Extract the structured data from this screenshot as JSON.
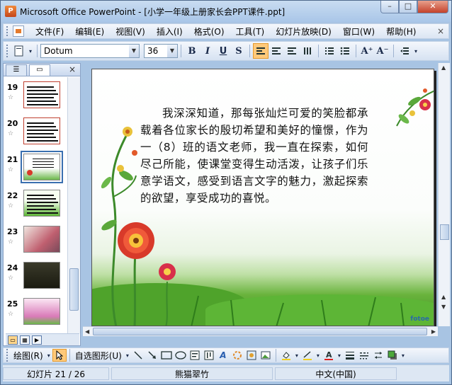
{
  "window": {
    "title": "Microsoft Office PowerPoint - [小学一年级上册家长会PPT课件.ppt]",
    "app_icon": "P",
    "controls": {
      "minimize": "–",
      "maximize": "□",
      "close": "✕"
    }
  },
  "menu": {
    "items": [
      "文件(F)",
      "编辑(E)",
      "视图(V)",
      "插入(I)",
      "格式(O)",
      "工具(T)",
      "幻灯片放映(D)",
      "窗口(W)",
      "帮助(H)"
    ],
    "close_glyph": "×"
  },
  "toolbar": {
    "font_name": "Dotum",
    "font_size": "36",
    "bold": "B",
    "italic": "I",
    "underline": "U",
    "shadow": "S",
    "grow_font": "A⁺",
    "shrink_font": "A⁻"
  },
  "left_pane": {
    "tabs": [
      "☰",
      "▭"
    ],
    "close_glyph": "×",
    "slides": [
      {
        "number": "19",
        "theme": "dark-lines"
      },
      {
        "number": "20",
        "theme": "dark-lines"
      },
      {
        "number": "21",
        "theme": "flowers",
        "selected": true
      },
      {
        "number": "22",
        "theme": "green"
      },
      {
        "number": "23",
        "theme": "photo"
      },
      {
        "number": "24",
        "theme": "dark"
      },
      {
        "number": "25",
        "theme": "pink"
      }
    ],
    "star_glyph": "☆"
  },
  "slide": {
    "body_text": "我深深知道，那每张灿烂可爱的笑脸都承载着各位家长的殷切希望和美好的憧憬，作为一（8）班的语文老师，我一直在探索，如何尽己所能，使课堂变得生动活泼，让孩子们乐意学语文，感受到语言文字的魅力，激起探索的欲望，享受成功的喜悦。",
    "watermark": "fotoe"
  },
  "draw_toolbar": {
    "draw_label": "绘图(R)",
    "autoshapes_label": "自选图形(U)"
  },
  "status": {
    "slide_indicator": "幻灯片 21 / 26",
    "design": "熊猫翠竹",
    "language": "中文(中国)"
  },
  "colors": {
    "accent_orange": "#ffc97a",
    "chrome_blue": "#a8c4e3",
    "grass_green": "#3b8f22"
  }
}
